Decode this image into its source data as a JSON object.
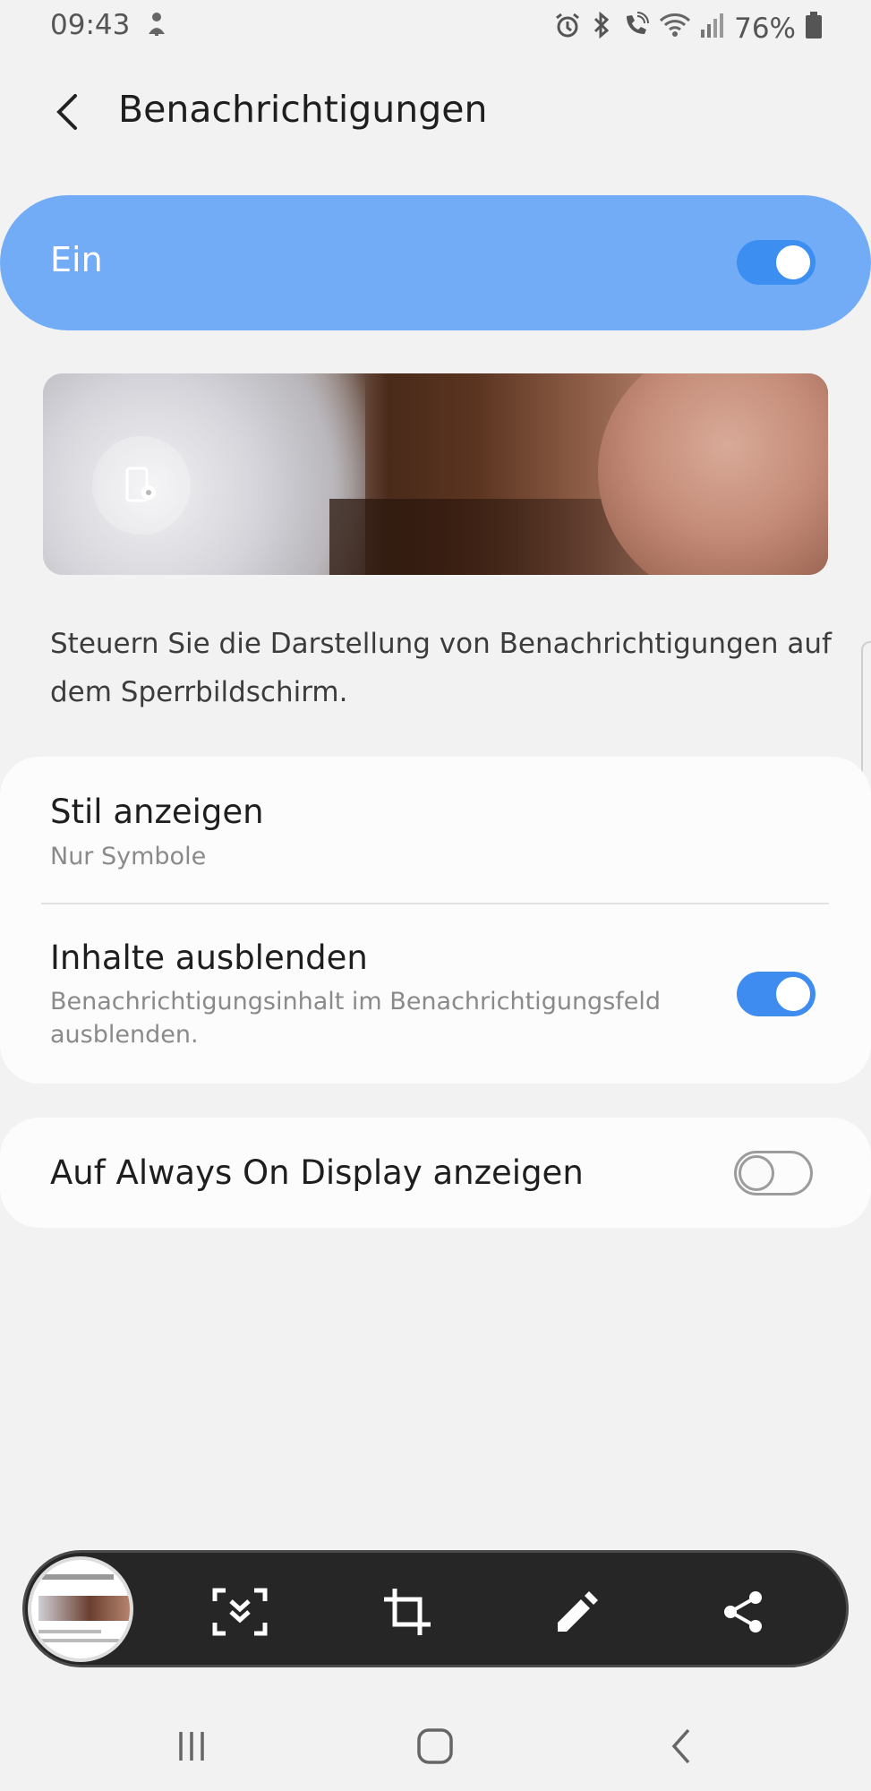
{
  "status_bar": {
    "time": "09:43",
    "battery": "76%",
    "icons": [
      "mute-icon",
      "alarm-icon",
      "bluetooth-icon",
      "wifi-call-icon",
      "wifi-icon",
      "signal-icon",
      "battery-icon"
    ]
  },
  "header": {
    "title": "Benachrichtigungen",
    "back_icon": "chevron-left-icon"
  },
  "master": {
    "label": "Ein",
    "enabled": true
  },
  "preview": {
    "settings_icon": "device-settings-icon"
  },
  "description": "Steuern Sie die Darstellung von Benachrichtigungen auf dem Sperrbildschirm.",
  "settings": {
    "style": {
      "title": "Stil anzeigen",
      "value": "Nur Symbole"
    },
    "hide_content": {
      "title": "Inhalte ausblenden",
      "subtitle": "Benachrichtigungsinhalt im Benachrichtigungsfeld ausblenden.",
      "enabled": true
    },
    "aod": {
      "title": "Auf Always On Display anzeigen",
      "enabled": false
    }
  },
  "toolbar": {
    "buttons": [
      "scroll-capture-icon",
      "crop-icon",
      "pen-icon",
      "share-icon"
    ]
  },
  "navbar": {
    "buttons": [
      "recents-icon",
      "home-icon",
      "back-icon"
    ]
  },
  "colors": {
    "accent": "#3e8cf0",
    "master_bg": "#72acf7",
    "background": "#f2f2f2",
    "toolbar_bg": "#262626"
  }
}
